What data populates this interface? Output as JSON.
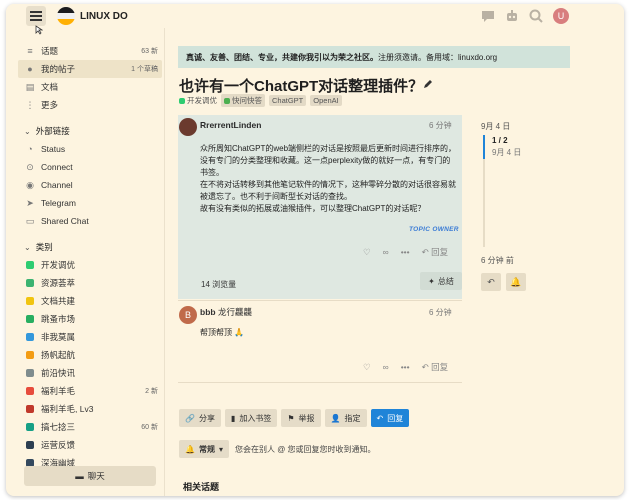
{
  "header": {
    "site_name": "LINUX DO",
    "avatar_letter": "U"
  },
  "sidebar": {
    "items": [
      {
        "label": "话题",
        "badge": "63 新",
        "icon": "topics-icon"
      },
      {
        "label": "我的帖子",
        "badge": "1 个草稿",
        "icon": "user-icon"
      },
      {
        "label": "文档",
        "badge": "",
        "icon": "document-icon"
      },
      {
        "label": "更多",
        "badge": "",
        "icon": "more-icon"
      }
    ],
    "links_header": "外部链接",
    "links": [
      {
        "label": "Status",
        "icon": "status-icon"
      },
      {
        "label": "Connect",
        "icon": "connect-icon"
      },
      {
        "label": "Channel",
        "icon": "channel-icon"
      },
      {
        "label": "Telegram",
        "icon": "telegram-icon"
      },
      {
        "label": "Shared Chat",
        "icon": "chat-icon"
      }
    ],
    "categories_header": "类别",
    "categories": [
      {
        "label": "开发调优",
        "badge": "",
        "color": "#2ecc71"
      },
      {
        "label": "资源荟萃",
        "badge": "",
        "color": "#3cb371"
      },
      {
        "label": "文档共建",
        "badge": "",
        "color": "#f1c40f"
      },
      {
        "label": "跳蚤市场",
        "badge": "",
        "color": "#27ae60"
      },
      {
        "label": "非我莫属",
        "badge": "",
        "color": "#3498db"
      },
      {
        "label": "扬帆起航",
        "badge": "",
        "color": "#f39c12"
      },
      {
        "label": "前沿快讯",
        "badge": "",
        "color": "#7f8c8d"
      },
      {
        "label": "福利羊毛",
        "badge": "2 新",
        "color": "#e74c3c"
      },
      {
        "label": "福利羊毛, Lv3",
        "badge": "",
        "color": "#c0392b"
      },
      {
        "label": "搞七捻三",
        "badge": "60 新",
        "color": "#16a085"
      },
      {
        "label": "运营反馈",
        "badge": "",
        "color": "#2c3e50"
      },
      {
        "label": "深海幽域",
        "badge": "",
        "color": "#34495e"
      }
    ],
    "chat_label": "聊天"
  },
  "banner": {
    "bold": "真诚、友善、团结、专业，共建你我引以为荣之社区。",
    "text": "注册须邀请。备用域：linuxdo.org"
  },
  "topic": {
    "title": "也许有一个ChatGPT对话整理插件？",
    "category": "开发调优",
    "tags": [
      "快问快答",
      "ChatGPT",
      "OpenAI"
    ]
  },
  "posts": [
    {
      "author": "RrerrentLinden",
      "time": "6 分钟",
      "body": [
        "众所周知ChatGPT的web端侧栏的对话是按照最后更新时间进行排序的，没有专门的分类整理和收藏。这一点perplexity做的就好一点，有专门的书签。",
        "在不将对话转移到其他笔记软件的情况下，这种零碎分散的对话很容易就被遗忘了。也不利于间断型长对话的查找。",
        "故有没有类似的拓展或油猴插件，可以整理ChatGPT的对话呢？"
      ],
      "owner_label": "TOPIC OWNER",
      "reply_label": "回复",
      "views": "14 浏览量",
      "summary_label": "总结"
    },
    {
      "author": "bbb",
      "author_suffix": "龙行龘龘",
      "time": "6 分钟",
      "body": "帮顶帮顶 🙏",
      "reply_label": "回复"
    }
  ],
  "footer_buttons": {
    "share": "分享",
    "bookmark": "加入书签",
    "flag": "举报",
    "assign": "指定",
    "reply": "回复"
  },
  "notification": {
    "level": "常规",
    "text": "您会在别人 @ 您或回复您时收到通知。"
  },
  "related_title": "相关话题",
  "timeline": {
    "start_date": "9月 4 日",
    "position": "1 / 2",
    "position_date": "9月 4 日",
    "end_label": "6 分钟 前"
  },
  "colors": {
    "accent": "#1f84d8",
    "background": "#fdf4e0",
    "banner": "#d1e3da",
    "post_highlight": "#dfe8e1"
  }
}
